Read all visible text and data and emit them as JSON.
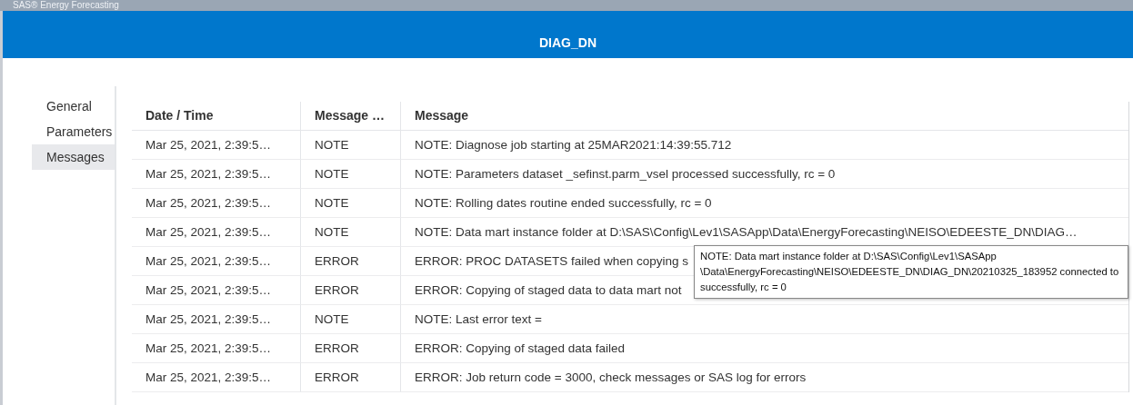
{
  "app": {
    "title": "SAS® Energy Forecasting"
  },
  "dialog": {
    "title": "DIAG_DN"
  },
  "sidebar": {
    "items": [
      {
        "label": "General",
        "selected": false
      },
      {
        "label": "Parameters",
        "selected": false
      },
      {
        "label": "Messages",
        "selected": true
      }
    ]
  },
  "table": {
    "columns": [
      "Date / Time",
      "Message …",
      "Message"
    ],
    "rows": [
      {
        "datetime": "Mar 25, 2021, 2:39:5…",
        "type": "NOTE",
        "message": "NOTE: Diagnose job starting at 25MAR2021:14:39:55.712"
      },
      {
        "datetime": "Mar 25, 2021, 2:39:5…",
        "type": "NOTE",
        "message": "NOTE: Parameters dataset _sefinst.parm_vsel processed successfully, rc = 0"
      },
      {
        "datetime": "Mar 25, 2021, 2:39:5…",
        "type": "NOTE",
        "message": "NOTE: Rolling dates routine ended successfully, rc = 0"
      },
      {
        "datetime": "Mar 25, 2021, 2:39:5…",
        "type": "NOTE",
        "message": "NOTE: Data mart instance folder at D:\\SAS\\Config\\Lev1\\SASApp\\Data\\EnergyForecasting\\NEISO\\EDEESTE_DN\\DIAG…"
      },
      {
        "datetime": "Mar 25, 2021, 2:39:5…",
        "type": "ERROR",
        "message": "ERROR: PROC DATASETS failed when copying s"
      },
      {
        "datetime": "Mar 25, 2021, 2:39:5…",
        "type": "ERROR",
        "message": "ERROR: Copying of staged data to data mart not"
      },
      {
        "datetime": "Mar 25, 2021, 2:39:5…",
        "type": "NOTE",
        "message": "NOTE: Last error text ="
      },
      {
        "datetime": "Mar 25, 2021, 2:39:5…",
        "type": "ERROR",
        "message": "ERROR: Copying of staged data failed"
      },
      {
        "datetime": "Mar 25, 2021, 2:39:5…",
        "type": "ERROR",
        "message": "ERROR: Job return code = 3000, check messages or SAS log for errors"
      }
    ]
  },
  "tooltip": {
    "text": "NOTE: Data mart instance folder at D:\\SAS\\Config\\Lev1\\SASApp \\Data\\EnergyForecasting\\NEISO\\EDEESTE_DN\\DIAG_DN\\20210325_183952 connected to successfully, rc = 0"
  }
}
